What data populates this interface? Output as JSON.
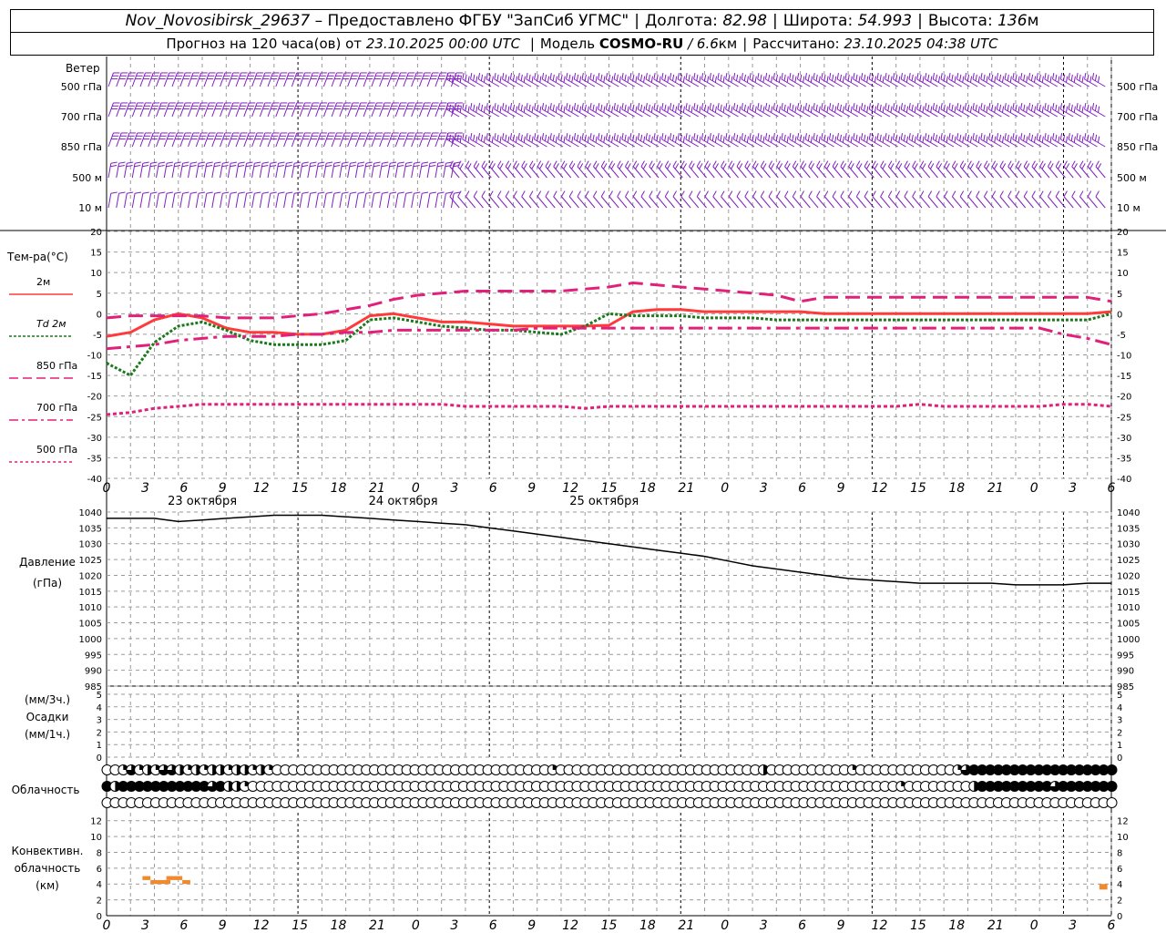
{
  "header": {
    "station": "Nov_Novosibirsk_29637",
    "provider": "– Предоставлено ФГБУ \"ЗапСиб УГМС\"",
    "lon_label": "Долгота:",
    "lon": "82.98",
    "lat_label": "Широта:",
    "lat": "54.993",
    "alt_label": "Высота:",
    "alt": "136",
    "alt_unit": "м",
    "forecast_label": "Прогноз на 120 часа(ов) от",
    "forecast_time": "23.10.2025 00:00 UTC",
    "model_label": "Модель",
    "model": "COSMO-RU",
    "resolution": "/ 6.6",
    "res_unit": "км",
    "calc_label": "Рассчитано:",
    "calc_time": "23.10.2025 04:38 UTC"
  },
  "labels": {
    "wind": "Ветер",
    "wind_levels": [
      "500 гПа",
      "700 гПа",
      "850 гПа",
      "500 м",
      "10 м"
    ],
    "temp": "Тем-ра(°С)",
    "legend": [
      "2м",
      "Td 2м",
      "850 гПа",
      "700 гПа",
      "500 гПа"
    ],
    "pressure": [
      "Давление",
      "(гПа)"
    ],
    "precip": [
      "(мм/3ч.)",
      "Осадки",
      "(мм/1ч.)"
    ],
    "cloud": "Облачность",
    "conv": [
      "Конвективн.",
      "облачность",
      "(км)"
    ]
  },
  "colors": {
    "t2m": "#ff3a3a",
    "td2m": "#1a7a1a",
    "t850": "#e0207a",
    "t700": "#e0207a",
    "t500": "#e0207a",
    "wind": "#8020c0",
    "pressure": "#000000",
    "conv": "#f08a30",
    "grid": "#9a9a9a"
  },
  "chart_data": [
    {
      "type": "line",
      "name": "temperature",
      "x_hours": [
        0,
        3,
        6,
        9,
        12,
        15,
        18,
        21,
        24,
        27,
        30,
        33,
        36,
        39,
        42,
        45,
        48,
        51,
        54,
        57,
        60,
        63,
        66,
        69,
        72,
        75,
        78,
        81,
        84,
        87,
        90,
        93,
        96,
        99,
        102,
        105,
        108,
        111,
        114,
        117,
        120,
        123,
        126
      ],
      "x_tick_labels": [
        "0",
        "3",
        "6",
        "9",
        "12",
        "15",
        "18",
        "21",
        "0",
        "3",
        "6",
        "9",
        "12",
        "15",
        "18",
        "21",
        "0",
        "3",
        "6",
        "9",
        "12",
        "15",
        "18",
        "21",
        "0",
        "3",
        "6"
      ],
      "date_labels": [
        "23 октября",
        "24 октября",
        "25 октября"
      ],
      "ylim": [
        -40,
        20
      ],
      "yticks": [
        20,
        15,
        10,
        5,
        0,
        -5,
        -10,
        -15,
        -20,
        -25,
        -30,
        -35,
        -40
      ],
      "series": [
        {
          "key": "t2m",
          "values": [
            -5.5,
            -4.5,
            -1.5,
            0,
            -1,
            -3.5,
            -4.5,
            -4.5,
            -5,
            -5,
            -4,
            -0.5,
            0,
            -1,
            -2,
            -2,
            -2.5,
            -3,
            -3,
            -3,
            -3,
            -2.8,
            0.5,
            1,
            1,
            0.5,
            0.5,
            0.5,
            0.5,
            0.5,
            0,
            0,
            0,
            0,
            0,
            0,
            0,
            0,
            0,
            0,
            0,
            0,
            0.5
          ]
        },
        {
          "key": "td2m",
          "values": [
            -12,
            -15,
            -7,
            -3,
            -2,
            -4,
            -6.5,
            -7.5,
            -7.5,
            -7.5,
            -6.5,
            -1.5,
            -1,
            -2,
            -3,
            -3.5,
            -4,
            -4,
            -4.5,
            -5,
            -3,
            0,
            -0.5,
            -0.5,
            -0.5,
            -1,
            -1,
            -1,
            -1.5,
            -1.5,
            -1.5,
            -1.5,
            -1.5,
            -1.5,
            -1.5,
            -1.5,
            -1.5,
            -1.5,
            -1.5,
            -1.5,
            -1.5,
            -1.5,
            0
          ]
        },
        {
          "key": "t850",
          "values": [
            -1,
            -0.5,
            -0.5,
            -0.5,
            -0.5,
            -1,
            -1,
            -1,
            -0.5,
            0,
            1,
            2,
            3.5,
            4.5,
            5,
            5.5,
            5.5,
            5.5,
            5.5,
            5.5,
            6,
            6.5,
            7.5,
            7,
            6.5,
            6,
            5.5,
            5,
            4.5,
            3,
            4,
            4,
            4,
            4,
            4,
            4,
            4,
            4,
            4,
            4,
            4,
            4,
            3
          ]
        },
        {
          "key": "t700",
          "values": [
            -8.5,
            -8,
            -7.5,
            -6.5,
            -6,
            -5.5,
            -5.5,
            -5.5,
            -5,
            -5,
            -4.5,
            -4.5,
            -4,
            -4,
            -4,
            -4,
            -4,
            -4,
            -3.5,
            -3.5,
            -3.5,
            -3.5,
            -3.5,
            -3.5,
            -3.5,
            -3.5,
            -3.5,
            -3.5,
            -3.5,
            -3.5,
            -3.5,
            -3.5,
            -3.5,
            -3.5,
            -3.5,
            -3.5,
            -3.5,
            -3.5,
            -3.5,
            -3.5,
            -5,
            -6,
            -7.5
          ]
        },
        {
          "key": "t500",
          "values": [
            -24.5,
            -24,
            -23,
            -22.5,
            -22,
            -22,
            -22,
            -22,
            -22,
            -22,
            -22,
            -22,
            -22,
            -22,
            -22,
            -22.5,
            -22.5,
            -22.5,
            -22.5,
            -22.5,
            -23,
            -22.5,
            -22.5,
            -22.5,
            -22.5,
            -22.5,
            -22.5,
            -22.5,
            -22.5,
            -22.5,
            -22.5,
            -22.5,
            -22.5,
            -22.5,
            -22,
            -22.5,
            -22.5,
            -22.5,
            -22.5,
            -22.5,
            -22,
            -22,
            -22.5
          ]
        }
      ]
    },
    {
      "type": "line",
      "name": "pressure",
      "x_hours": [
        0,
        3,
        6,
        9,
        12,
        15,
        18,
        21,
        24,
        27,
        30,
        33,
        36,
        39,
        42,
        45,
        48,
        51,
        54,
        57,
        60,
        63,
        66,
        69,
        72,
        75,
        78,
        81,
        84,
        87,
        90,
        93,
        96,
        99,
        102,
        105,
        108,
        111,
        114,
        117,
        120,
        123,
        126
      ],
      "ylim": [
        985,
        1040
      ],
      "yticks": [
        1040,
        1035,
        1030,
        1025,
        1020,
        1015,
        1010,
        1005,
        1000,
        995,
        990,
        985
      ],
      "values": [
        1038,
        1038,
        1038,
        1037,
        1037.5,
        1038,
        1038.5,
        1039,
        1039,
        1039,
        1038.5,
        1038,
        1037.5,
        1037,
        1036.5,
        1036,
        1035,
        1034,
        1033,
        1032,
        1031,
        1030,
        1029,
        1028,
        1027,
        1026,
        1024.5,
        1023,
        1022,
        1021,
        1020,
        1019,
        1018.5,
        1018,
        1017.5,
        1017.5,
        1017.5,
        1017.5,
        1017,
        1017,
        1017,
        1017.5,
        1017.5
      ]
    },
    {
      "type": "bar",
      "name": "precipitation",
      "ylim": [
        0,
        5
      ],
      "yticks": [
        5,
        4,
        3,
        2,
        1,
        0
      ],
      "values": []
    },
    {
      "type": "bar",
      "name": "convective_cloud",
      "ylim": [
        0,
        13
      ],
      "yticks": [
        12,
        10,
        8,
        6,
        4,
        2,
        0
      ],
      "segments": [
        {
          "x0": 4.5,
          "x1": 5.5,
          "y0": 4.5,
          "y1": 5
        },
        {
          "x0": 5.5,
          "x1": 8,
          "y0": 4,
          "y1": 4.5
        },
        {
          "x0": 7.5,
          "x1": 9.5,
          "y0": 4.5,
          "y1": 5
        },
        {
          "x0": 9.5,
          "x1": 10.5,
          "y0": 4,
          "y1": 4.5
        },
        {
          "x0": 124.5,
          "x1": 125.5,
          "y0": 3.3,
          "y1": 4
        }
      ]
    },
    {
      "type": "table",
      "name": "cloud_cover",
      "rows": [
        "high",
        "middle",
        "low"
      ],
      "levels_octas_0_to_4": {
        "high": [
          0,
          0,
          1,
          3,
          1,
          2,
          1,
          3,
          3,
          2,
          1,
          2,
          1,
          2,
          2,
          1,
          2,
          2,
          1,
          2,
          1,
          0,
          0,
          0,
          0,
          0,
          0,
          0,
          0,
          0,
          0,
          0,
          0,
          0,
          0,
          0,
          0,
          0,
          0,
          0,
          0,
          0,
          0,
          0,
          0,
          0,
          0,
          0,
          0,
          0,
          0,
          0,
          0,
          0,
          0,
          1,
          0,
          0,
          0,
          0,
          0,
          0,
          0,
          0,
          0,
          0,
          0,
          0,
          0,
          0,
          0,
          0,
          0,
          0,
          0,
          0,
          0,
          0,
          0,
          0,
          0,
          2,
          0,
          0,
          0,
          0,
          0,
          0,
          0,
          0,
          0,
          0,
          1,
          0,
          0,
          0,
          0,
          0,
          0,
          0,
          0,
          0,
          0,
          0,
          0,
          1,
          3,
          4,
          4,
          4,
          4,
          4,
          4,
          4,
          4,
          4,
          4,
          4,
          4,
          4,
          4,
          4,
          4,
          4,
          4,
          3
        ],
        "middle": [
          4,
          2,
          4,
          4,
          4,
          4,
          4,
          4,
          4,
          4,
          4,
          4,
          4,
          3,
          4,
          2,
          2,
          1,
          0,
          0,
          0,
          0,
          0,
          0,
          0,
          0,
          0,
          0,
          0,
          0,
          0,
          0,
          0,
          0,
          0,
          0,
          0,
          0,
          0,
          0,
          0,
          0,
          0,
          0,
          0,
          0,
          0,
          0,
          0,
          0,
          0,
          0,
          0,
          0,
          0,
          0,
          0,
          0,
          0,
          0,
          0,
          0,
          0,
          0,
          0,
          0,
          0,
          0,
          0,
          0,
          0,
          0,
          0,
          0,
          0,
          0,
          0,
          0,
          0,
          0,
          0,
          0,
          0,
          0,
          0,
          0,
          0,
          0,
          0,
          0,
          0,
          0,
          0,
          0,
          0,
          0,
          0,
          0,
          1,
          0,
          0,
          0,
          0,
          0,
          0,
          0,
          0,
          2,
          4,
          4,
          4,
          4,
          4,
          4,
          4,
          4,
          4,
          3,
          4,
          4,
          4,
          4,
          4,
          4,
          4
        ],
        "low": []
      }
    },
    {
      "type": "scatter",
      "name": "wind_barbs",
      "levels": [
        "500 гПа",
        "700 гПа",
        "850 гПа",
        "500 м",
        "10 м"
      ],
      "note_levels_y": [
        95,
        128,
        161,
        195,
        228
      ]
    }
  ]
}
